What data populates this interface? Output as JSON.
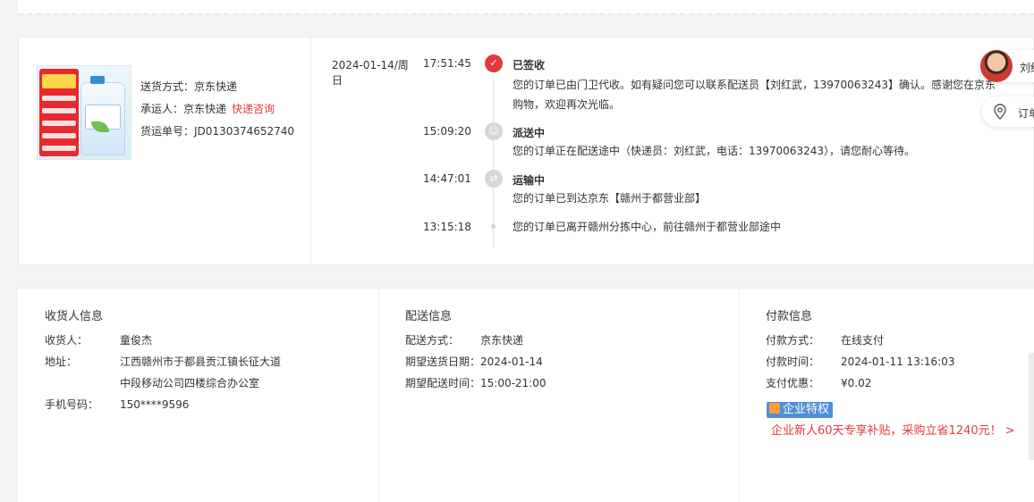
{
  "shipment": {
    "method_label": "送货方式：",
    "method_value": "京东快递",
    "carrier_label": "承运人：",
    "carrier_value": "京东快递",
    "carrier_link": "快递咨询",
    "tracking_label": "货运单号：",
    "tracking_value": "JD0130374652740"
  },
  "timeline": [
    {
      "date": "2024-01-14/周日",
      "time": "17:51:45",
      "title": "已签收",
      "icon": "check-circle-icon",
      "desc": "您的订单已由门卫代收。如有疑问您可以联系配送员【刘红武，13970063243】确认。感谢您在京东购物，欢迎再次光临。"
    },
    {
      "date": "",
      "time": "15:09:20",
      "title": "派送中",
      "icon": "courier-icon",
      "desc": "您的订单正在配送途中（快递员：刘红武，电话：13970063243），请您耐心等待。"
    },
    {
      "date": "",
      "time": "14:47:01",
      "title": "运输中",
      "icon": "truck-icon",
      "desc": "您的订单已到达京东【赣州于都营业部】"
    },
    {
      "date": "",
      "time": "13:15:18",
      "title": "",
      "icon": "dot-icon",
      "desc": "您的订单已离开赣州分拣中心，前往赣州于都营业部途中"
    }
  ],
  "side": {
    "courier_name": "刘红",
    "order_label": "订单"
  },
  "receiver": {
    "heading": "收货人信息",
    "name_label": "收货人：",
    "name_value": "童俊杰",
    "address_label": "地址：",
    "address_value": "江西赣州市于都县贡江镇长征大道中段移动公司四楼综合办公室",
    "phone_label": "手机号码：",
    "phone_value": "150****9596"
  },
  "delivery": {
    "heading": "配送信息",
    "method_label": "配送方式：",
    "method_value": "京东快递",
    "date_label": "期望送货日期：",
    "date_value": "2024-01-14",
    "time_label": "期望配送时间：",
    "time_value": "15:00-21:00"
  },
  "payment": {
    "heading": "付款信息",
    "method_label": "付款方式：",
    "method_value": "在线支付",
    "time_label": "付款时间：",
    "time_value": "2024-01-11 13:16:03",
    "discount_label": "支付优惠：",
    "discount_value": "¥0.02",
    "badge": "企业特权",
    "promo": "企业新人60天专享补贴，采购立省1240元！ >"
  },
  "colors": {
    "accent": "#e4393c",
    "badge_blue": "#4f8ed8",
    "muted_dot": "#d6d6d6"
  }
}
